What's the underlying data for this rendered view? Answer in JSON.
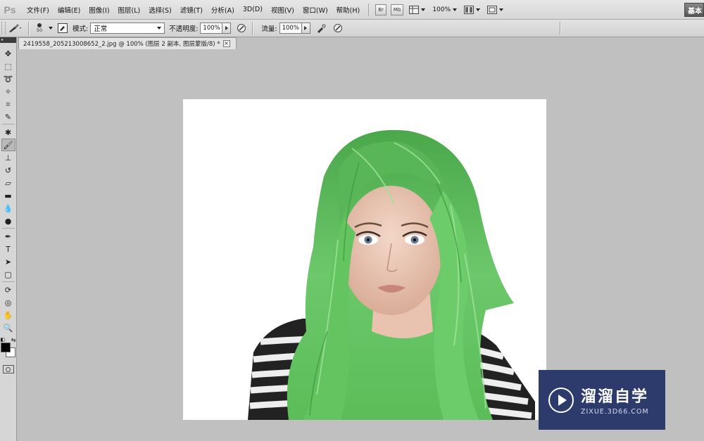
{
  "app": {
    "logo": "Ps"
  },
  "menu": {
    "items": [
      "文件(F)",
      "编辑(E)",
      "图像(I)",
      "图层(L)",
      "选择(S)",
      "滤镜(T)",
      "分析(A)",
      "3D(D)",
      "视图(V)",
      "窗口(W)",
      "帮助(H)"
    ],
    "bridge_button": "Br",
    "minibridge_button": "Mb",
    "zoom": "100%",
    "workspace": "基本"
  },
  "options": {
    "brush_size": "50",
    "mode_label": "模式:",
    "mode_value": "正常",
    "opacity_label": "不透明度:",
    "opacity_value": "100%",
    "flow_label": "流量:",
    "flow_value": "100%"
  },
  "document": {
    "tab_title": "2419558_205213008652_2.jpg @ 100% (图层 2 副本, 图层蒙版/8) *",
    "close_label": "×"
  },
  "watermark": {
    "name": "溜溜自学",
    "url": "ZIXUE.3D66.COM"
  },
  "colors": {
    "foreground": "#000000",
    "background": "#ffffff",
    "hair": "#5fbf5a",
    "watermark_bg": "#2c3b6b"
  }
}
